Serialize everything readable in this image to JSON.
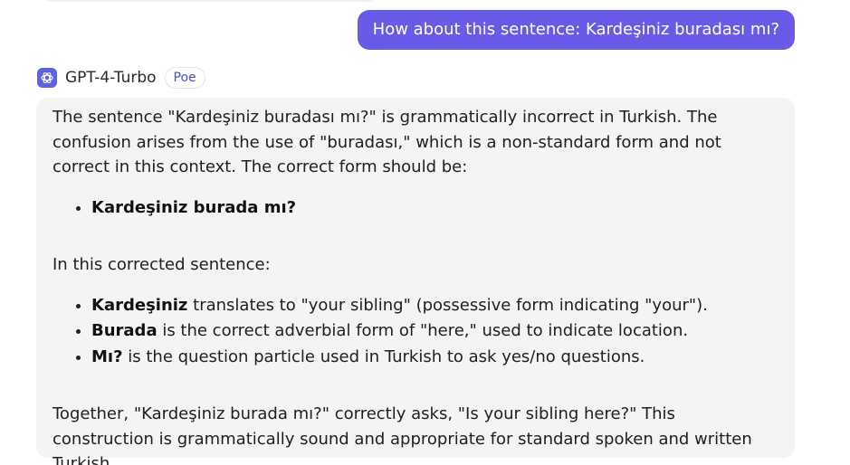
{
  "user_message": {
    "text": "How about this sentence: Kardeşiniz buradası mı?"
  },
  "bot": {
    "icon": "openai-logo-icon",
    "name": "GPT-4-Turbo",
    "tag": "Poe"
  },
  "response": {
    "intro": "The sentence \"Kardeşiniz buradası mı?\" is grammatically incorrect in Turkish. The confusion arises from the use of \"buradası,\" which is a non-standard form and not correct in this context. The correct form should be:",
    "correct_form": "Kardeşiniz burada mı?",
    "mid": "In this corrected sentence:",
    "points": [
      {
        "term": "Kardeşiniz",
        "desc": " translates to \"your sibling\" (possessive form indicating \"your\")."
      },
      {
        "term": "Burada",
        "desc": " is the correct adverbial form of \"here,\" used to indicate location."
      },
      {
        "term": "Mı?",
        "desc": " is the question particle used in Turkish to ask yes/no questions."
      }
    ],
    "conclusion": "Together, \"Kardeşiniz burada mı?\" correctly asks, \"Is your sibling here?\" This construction is grammatically sound and appropriate for standard spoken and written Turkish."
  },
  "colors": {
    "user_bubble": "#6a5ae8",
    "bot_bubble": "#f4f4f5",
    "bot_avatar": "#5c63e0",
    "tag_text": "#4b4fc8"
  }
}
